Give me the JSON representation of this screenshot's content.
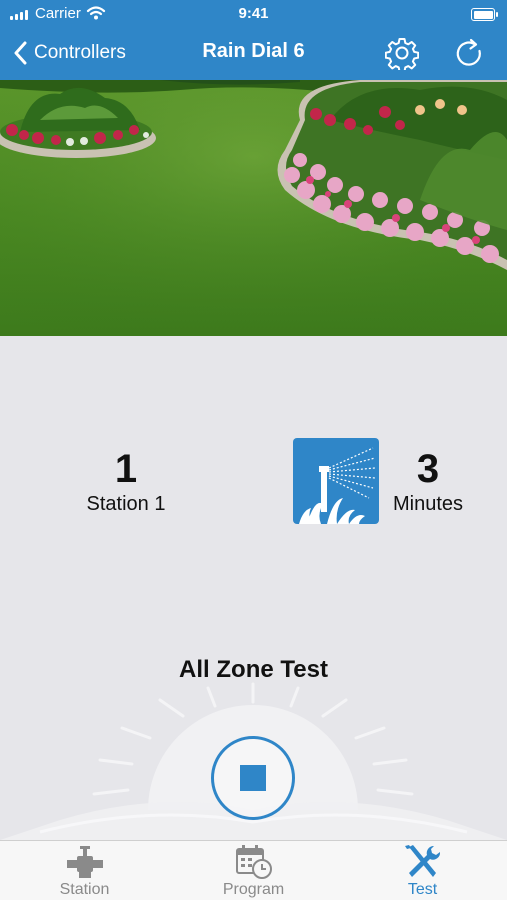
{
  "status_bar": {
    "carrier": "Carrier",
    "time": "9:41"
  },
  "nav": {
    "back_label": "Controllers",
    "title": "Rain Dial 6",
    "settings_icon": "gear-icon",
    "refresh_icon": "refresh-icon"
  },
  "station": {
    "number": "1",
    "name": "Station 1"
  },
  "duration": {
    "value": "3",
    "unit": "Minutes"
  },
  "test": {
    "title": "All Zone Test",
    "stop_icon": "stop-icon"
  },
  "tabs": [
    {
      "label": "Station",
      "icon": "valve-icon",
      "active": false
    },
    {
      "label": "Program",
      "icon": "calendar-clock-icon",
      "active": false
    },
    {
      "label": "Test",
      "icon": "tools-icon",
      "active": true
    }
  ],
  "colors": {
    "accent": "#2f86c8",
    "background": "#e6e6ea",
    "tab_inactive": "#8a8a8a"
  }
}
